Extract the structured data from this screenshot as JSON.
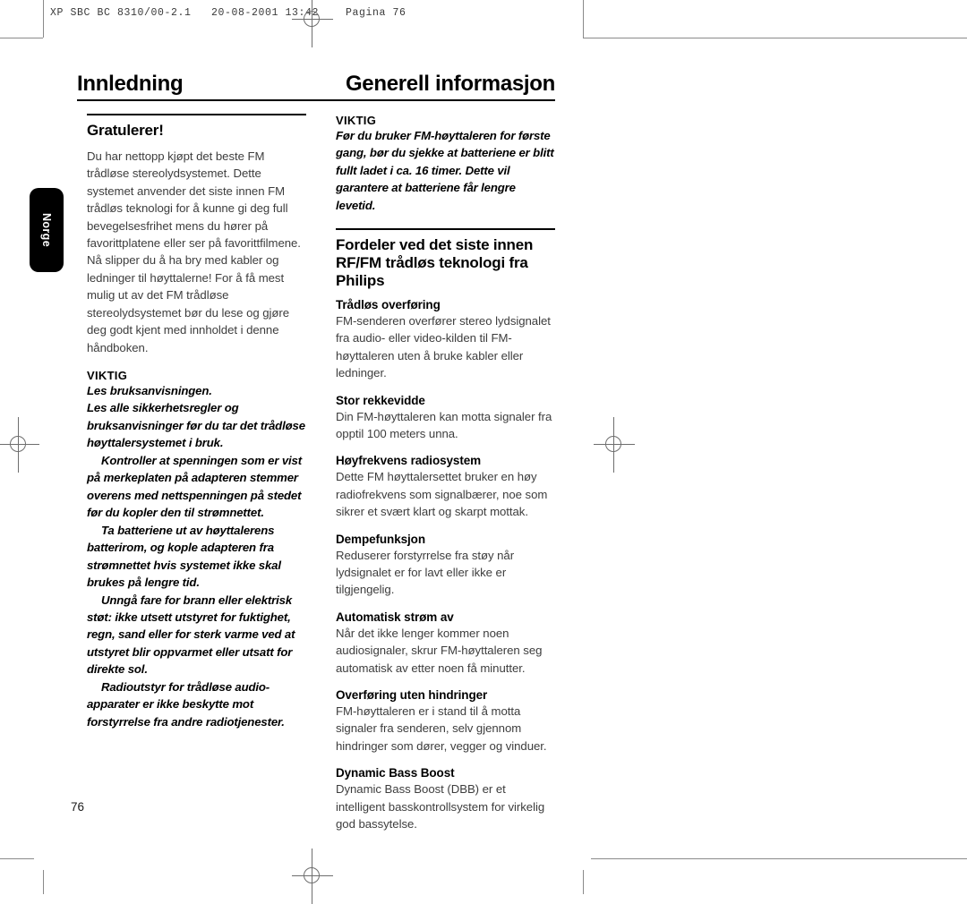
{
  "prepress": {
    "header_line": "XP SBC BC 8310/00-2.1   20-08-2001 13:42    Pagina 76"
  },
  "page": {
    "folio": "76",
    "language_tab": "Norge",
    "heading_left": "Innledning",
    "heading_right": "Generell informasjon"
  },
  "left_column": {
    "section_title": "Gratulerer!",
    "intro": "Du har nettopp kjøpt det beste FM trådløse stereolydsystemet. Dette systemet anvender det siste innen FM trådløs teknologi for å kunne gi deg full bevegelsesfrihet mens du hører på favorittplatene eller ser på favorittfilmene. Nå slipper du å ha bry med kabler og ledninger til høyttalerne! For å få mest mulig ut av det FM trådløse stereolydsystemet bør du lese og gjøre deg godt kjent med innholdet i denne håndboken.",
    "warning_label": "VIKTIG",
    "warning_1": "Les bruksanvisningen.",
    "warning_2": "Les alle sikkerhetsregler og bruksanvisninger før du tar det trådløse høyttalersystemet i bruk.",
    "warning_3": "Kontroller at spenningen som er vist på merkeplaten på adapteren stemmer overens med nettspenningen på stedet før du kopler den til strømnettet.",
    "warning_4": "Ta batteriene ut av høyttalerens batterirom, og kople adapteren fra strømnettet hvis systemet ikke skal brukes på lengre tid.",
    "warning_5": "Unngå fare for brann eller elektrisk støt: ikke utsett utstyret for fuktighet, regn, sand eller for sterk varme ved at utstyret blir oppvarmet eller utsatt for direkte sol.",
    "warning_6": "Radioutstyr for trådløse audio-apparater er ikke beskytte mot forstyrrelse fra andre radiotjenester."
  },
  "right_column": {
    "warning_label": "VIKTIG",
    "warning_text": "Før du bruker FM-høyttaleren for første gang, bør du sjekke at batteriene er blitt fullt ladet i ca. 16 timer. Dette vil garantere at batteriene får lengre levetid.",
    "section_title": "Fordeler ved det siste innen RF/FM trådløs teknologi fra Philips",
    "features": [
      {
        "title": "Trådløs overføring",
        "text": "FM-senderen overfører stereo lydsignalet fra audio- eller video-kilden til FM-høyttaleren uten å bruke kabler eller ledninger."
      },
      {
        "title": "Stor rekkevidde",
        "text": "Din FM-høyttaleren kan motta signaler fra opptil 100 meters unna."
      },
      {
        "title": "Høyfrekvens radiosystem",
        "text": "Dette FM høyttalersettet bruker en høy radiofrekvens som signalbærer, noe som sikrer et svært klart og skarpt mottak."
      },
      {
        "title": "Dempefunksjon",
        "text": "Reduserer forstyrrelse fra støy når lydsignalet er for lavt eller ikke er tilgjengelig."
      },
      {
        "title": "Automatisk strøm av",
        "text": "Når det ikke lenger kommer noen audiosignaler, skrur FM-høyttaleren seg automatisk av etter noen få minutter."
      },
      {
        "title": "Overføring uten hindringer",
        "text": "FM-høyttaleren er i stand til å motta signaler fra senderen, selv gjennom hindringer som dører, vegger og vinduer."
      },
      {
        "title": "Dynamic Bass Boost",
        "text": "Dynamic Bass Boost (DBB) er et intelligent basskontrollsystem for virkelig god bassytelse."
      }
    ]
  }
}
